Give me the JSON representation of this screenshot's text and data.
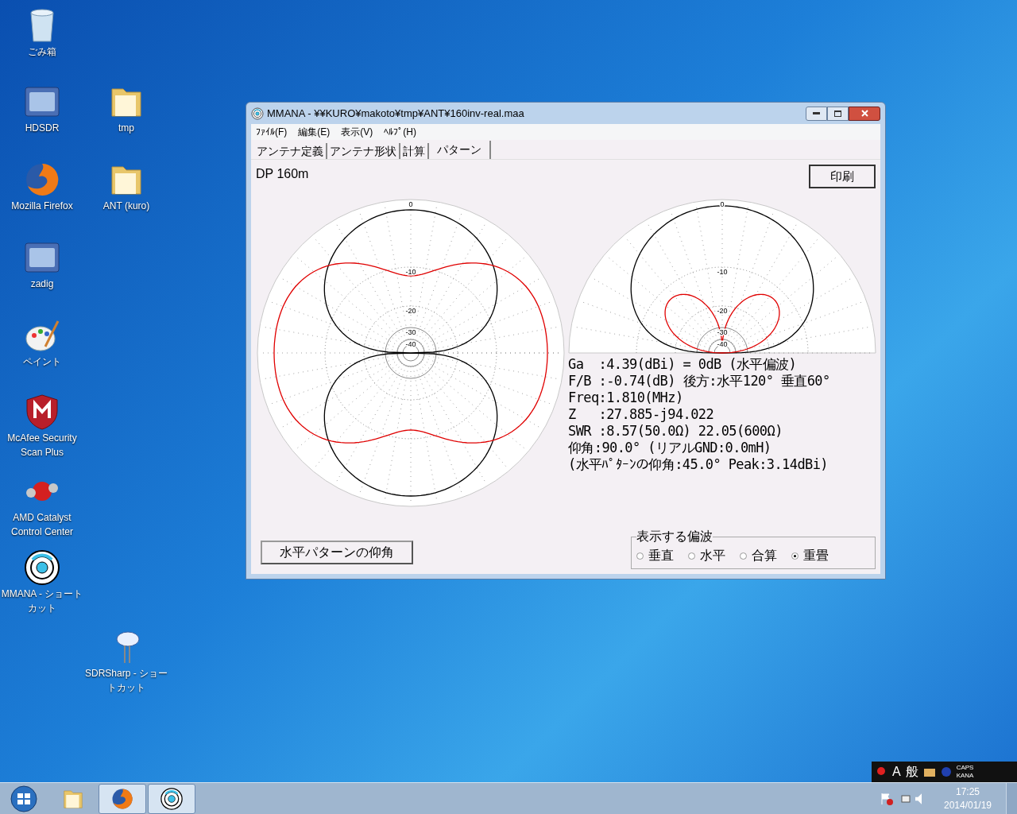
{
  "desktop_icons": [
    {
      "label": "ごみ箱",
      "kind": "trash"
    },
    {
      "label": "HDSDR",
      "kind": "tile"
    },
    {
      "label": "tmp",
      "kind": "folder"
    },
    {
      "label": "Mozilla Firefox",
      "kind": "globe"
    },
    {
      "label": "ANT (kuro)",
      "kind": "folder"
    },
    {
      "label": "zadig",
      "kind": "tile"
    },
    {
      "label": "ペイント",
      "kind": "palette"
    },
    {
      "label": "McAfee Security Scan Plus",
      "kind": "shield"
    },
    {
      "label": "AMD Catalyst Control Center",
      "kind": "ball"
    },
    {
      "label": "MMANA - ショートカット",
      "kind": "target"
    },
    {
      "label": "SDRSharp - ショートカット",
      "kind": "mouse"
    }
  ],
  "window": {
    "title": "MMANA - ¥¥KURO¥makoto¥tmp¥ANT¥160inv-real.maa",
    "menu": [
      "ﾌｧｲﾙ(F)",
      "編集(E)",
      "表示(V)",
      "ﾍﾙﾌﾟ(H)"
    ],
    "tabs": [
      {
        "label": "アンテナ定義",
        "selected": false
      },
      {
        "label": "アンテナ形状",
        "selected": false
      },
      {
        "label": "計算",
        "selected": false
      },
      {
        "label": "パターン",
        "selected": true
      }
    ],
    "antenna_name": "DP 160m",
    "print_button": "印刷",
    "horizontal_plot": {
      "ring_labels": [
        "0",
        "-10",
        "-20",
        "-30",
        "-40"
      ]
    },
    "vertical_plot": {
      "ring_labels": [
        "0",
        "-10",
        "-20",
        "-30",
        "-40"
      ]
    },
    "readout": [
      "Ga  :4.39(dBi) = 0dB (水平偏波)",
      "F/B :-0.74(dB) 後方:水平120° 垂直60°",
      "Freq:1.810(MHz)",
      "Z   :27.885-j94.022",
      "SWR :8.57(50.0Ω) 22.05(600Ω)",
      "仰角:90.0° (リアルGND:0.0mH)",
      "(水平ﾊﾟﾀｰﾝの仰角:45.0° Peak:3.14dBi)"
    ],
    "elevation_button": "水平パターンの仰角",
    "polarization": {
      "title": "表示する偏波",
      "options": [
        {
          "label": "垂直",
          "selected": false
        },
        {
          "label": "水平",
          "selected": false
        },
        {
          "label": "合算",
          "selected": false
        },
        {
          "label": "重畳",
          "selected": true
        }
      ]
    }
  },
  "language_bar": {
    "items": [
      "A",
      "般"
    ],
    "caps": "CAPS",
    "kana": "KANA"
  },
  "taskbar": {
    "items": [
      {
        "kind": "folder",
        "open": false
      },
      {
        "kind": "globe",
        "open": true
      },
      {
        "kind": "target",
        "open": true
      }
    ]
  },
  "clock": {
    "time": "17:25",
    "date": "2014/01/19"
  }
}
